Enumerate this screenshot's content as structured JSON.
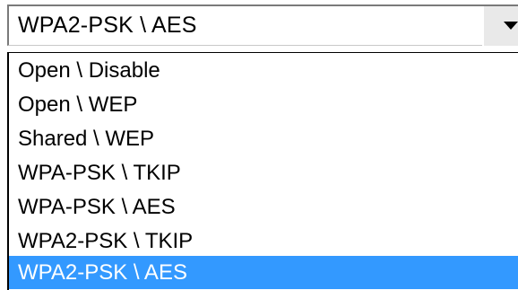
{
  "select": {
    "current_value": "WPA2-PSK \\ AES",
    "button_icon": "chevron-down-icon",
    "options": [
      {
        "label": "Open \\ Disable",
        "selected": false
      },
      {
        "label": "Open \\ WEP",
        "selected": false
      },
      {
        "label": "Shared \\ WEP",
        "selected": false
      },
      {
        "label": "WPA-PSK \\ TKIP",
        "selected": false
      },
      {
        "label": "WPA-PSK \\ AES",
        "selected": false
      },
      {
        "label": "WPA2-PSK \\ TKIP",
        "selected": false
      },
      {
        "label": "WPA2-PSK \\ AES",
        "selected": true
      }
    ]
  },
  "colors": {
    "highlight": "#3399ff",
    "highlight_text": "#ffffff"
  }
}
